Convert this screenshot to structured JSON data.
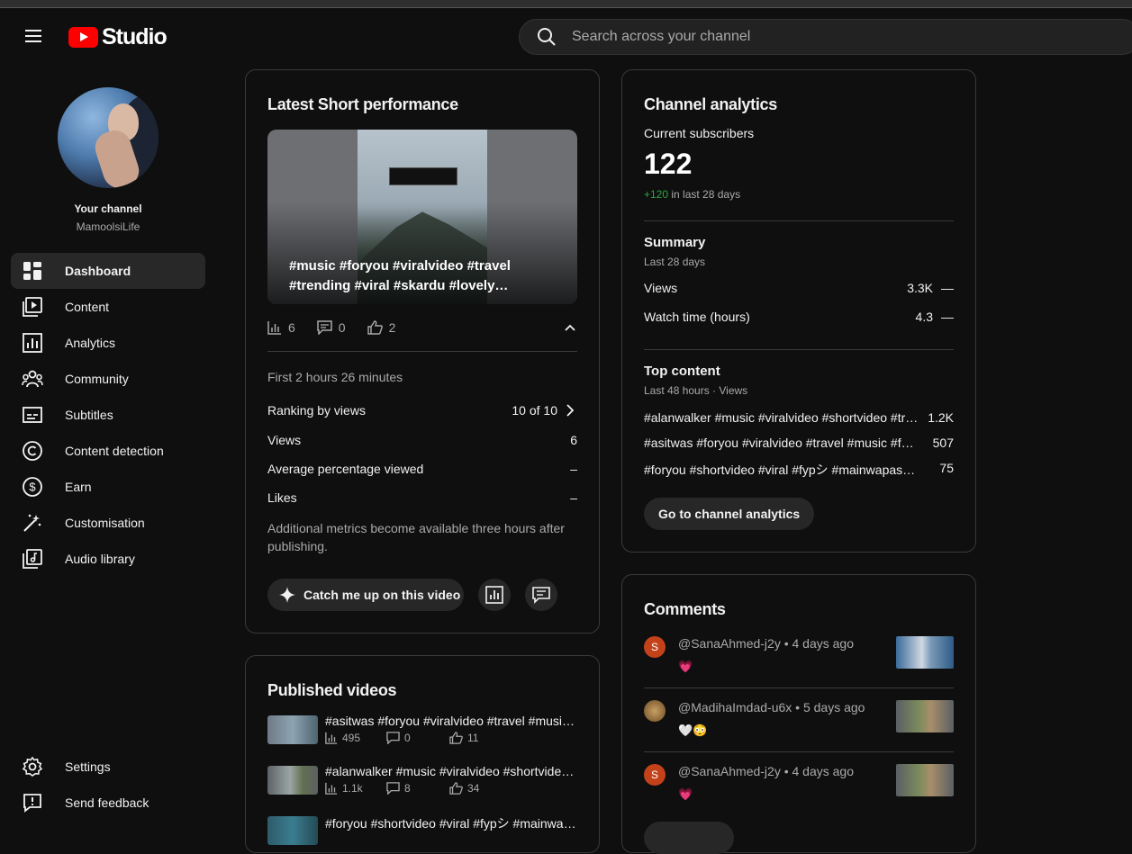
{
  "header": {
    "logo_text": "Studio",
    "search_placeholder": "Search across your channel"
  },
  "sidebar": {
    "channel_title": "Your channel",
    "channel_name": "MamoolsiLife",
    "items": [
      {
        "label": "Dashboard",
        "icon": "dashboard-icon",
        "active": true
      },
      {
        "label": "Content",
        "icon": "content-icon"
      },
      {
        "label": "Analytics",
        "icon": "analytics-icon"
      },
      {
        "label": "Community",
        "icon": "community-icon"
      },
      {
        "label": "Subtitles",
        "icon": "subtitles-icon"
      },
      {
        "label": "Content detection",
        "icon": "content-detection-icon"
      },
      {
        "label": "Earn",
        "icon": "earn-icon"
      },
      {
        "label": "Customisation",
        "icon": "customisation-icon"
      },
      {
        "label": "Audio library",
        "icon": "audio-library-icon"
      }
    ],
    "bottom_items": [
      {
        "label": "Settings",
        "icon": "gear-icon"
      },
      {
        "label": "Send feedback",
        "icon": "feedback-icon"
      }
    ]
  },
  "latest_short": {
    "title": "Latest Short performance",
    "video_title": "#music #foryou #viralvideo #travel #trending #viral #skardu #lovely…",
    "views": "6",
    "comments": "0",
    "likes": "2",
    "period": "First 2 hours 26 minutes",
    "ranking_label": "Ranking by views",
    "ranking_value": "10 of 10",
    "views_label": "Views",
    "views_value": "6",
    "avg_label": "Average percentage viewed",
    "avg_value": "–",
    "likes_label": "Likes",
    "likes_value": "–",
    "note": "Additional metrics become available three hours after publishing.",
    "catch_up_label": "Catch me up on this video"
  },
  "published": {
    "title": "Published videos",
    "videos": [
      {
        "title": "#asitwas #foryou #viralvideo #travel #music #foryoupage",
        "views": "495",
        "comments": "0",
        "likes": "11"
      },
      {
        "title": "#alanwalker #music #viralvideo #shortvideo #travel",
        "views": "1.1k",
        "comments": "8",
        "likes": "34"
      },
      {
        "title": "#foryou #shortvideo #viral #fypシ #mainwapasaaunga"
      }
    ]
  },
  "analytics": {
    "title": "Channel analytics",
    "subs_label": "Current subscribers",
    "subs_value": "122",
    "subs_delta": "+120",
    "subs_delta_suffix": " in last 28 days",
    "summary_title": "Summary",
    "summary_period": "Last 28 days",
    "views_label": "Views",
    "views_value": "3.3K",
    "views_trend": "—",
    "watch_label": "Watch time (hours)",
    "watch_value": "4.3",
    "watch_trend": "—",
    "top_title": "Top content",
    "top_period": "Last 48 hours · Views",
    "top": [
      {
        "title": "#alanwalker #music #viralvideo #shortvideo #travel",
        "views": "1.2K"
      },
      {
        "title": "#asitwas #foryou #viralvideo #travel #music #foryoupage",
        "views": "507"
      },
      {
        "title": "#foryou #shortvideo #viral #fypシ #mainwapasaaunga",
        "views": "75"
      }
    ],
    "cta": "Go to channel analytics"
  },
  "comments": {
    "title": "Comments",
    "items": [
      {
        "initial": "S",
        "user": "@SanaAhmed-j2y",
        "time": " • 4 days ago",
        "text": "💗"
      },
      {
        "initial": "",
        "user": "@MadihaImdad-u6x",
        "time": " • 5 days ago",
        "text": "🤍😳"
      },
      {
        "initial": "S",
        "user": "@SanaAhmed-j2y",
        "time": " • 4 days ago",
        "text": "💗"
      }
    ]
  }
}
